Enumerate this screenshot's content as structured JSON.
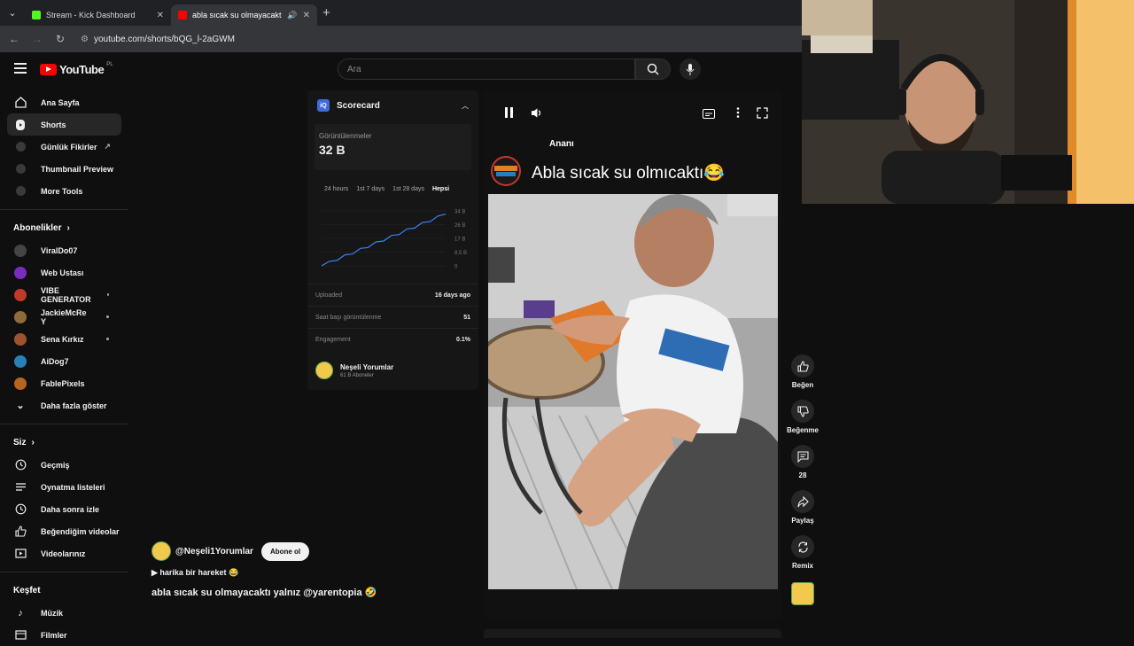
{
  "browser": {
    "tabs": [
      {
        "title": "Stream - Kick Dashboard",
        "favicon_color": "#53fc18"
      },
      {
        "title": "abla sıcak su olmayacaktı ya...",
        "favicon_color": "#ff0000"
      }
    ],
    "url": "youtube.com/shorts/bQG_l-2aGWM"
  },
  "header": {
    "logo": "YouTube",
    "country": "PL",
    "search_placeholder": "Ara"
  },
  "sidebar": {
    "main": [
      {
        "label": "Ana Sayfa",
        "icon": "home-icon"
      },
      {
        "label": "Shorts",
        "icon": "shorts-icon",
        "active": true
      },
      {
        "label": "Günlük Fikirler",
        "icon": "ext-app-icon"
      },
      {
        "label": "Thumbnail Preview",
        "icon": "ext-app-icon"
      },
      {
        "label": "More Tools",
        "icon": "ext-app-icon"
      }
    ],
    "subs_title": "Abonelikler",
    "subs": [
      {
        "label": "ViralDo07",
        "color": "#444"
      },
      {
        "label": "Web Ustası",
        "color": "#7b2cbf"
      },
      {
        "label": "VIBE GENERATOR",
        "color": "#c0392b"
      },
      {
        "label": "JackieMcRe Y",
        "color": "#8e6b3a"
      },
      {
        "label": "Sena Kırkız",
        "color": "#a0522d"
      },
      {
        "label": "AiDog7",
        "color": "#2980b9"
      },
      {
        "label": "FablePixels",
        "color": "#b5651d"
      }
    ],
    "show_more": "Daha fazla göster",
    "you_title": "Siz",
    "you": [
      {
        "label": "Geçmiş",
        "icon": "history-icon"
      },
      {
        "label": "Oynatma listeleri",
        "icon": "playlist-icon"
      },
      {
        "label": "Daha sonra izle",
        "icon": "clock-icon"
      },
      {
        "label": "Beğendiğim videolar",
        "icon": "like-icon"
      },
      {
        "label": "Videolarınız",
        "icon": "video-icon"
      }
    ],
    "explore_title": "Keşfet",
    "explore": [
      {
        "label": "Müzik",
        "icon": "music-icon"
      },
      {
        "label": "Filmler",
        "icon": "film-icon"
      }
    ]
  },
  "scorecard": {
    "title": "Scorecard",
    "views_label": "Görüntülenmeler",
    "views_value": "32 B",
    "ranges": [
      "24 hours",
      "1st 7 days",
      "1st 28 days",
      "Hepsi"
    ],
    "active_range": "Hepsi",
    "y_ticks": [
      "34 B",
      "26 B",
      "17 B",
      "8,5 B",
      "0"
    ],
    "stats": [
      {
        "label": "Uploaded",
        "value": "16 days ago"
      },
      {
        "label": "Saat başı görüntülenme",
        "value": "51"
      },
      {
        "label": "Engagement",
        "value": "0.1%"
      }
    ],
    "channel_name": "Neşeli Yorumlar",
    "channel_subs": "61 B Aboneler"
  },
  "player": {
    "overlay_label": "Ananı",
    "overlay_title": "Abla sıcak su olmıcaktı😂"
  },
  "caption": {
    "handle": "@Neşeli1Yorumlar",
    "subscribe": "Abone ol",
    "line": "▶ harika bir hareket 😂",
    "title": "abla sıcak su olmayacaktı yalnız @yarentopia 🤣"
  },
  "actions": [
    {
      "label": "Beğen",
      "icon": "thumbs-up-icon"
    },
    {
      "label": "Beğenme",
      "icon": "thumbs-down-icon"
    },
    {
      "label": "28",
      "icon": "comment-icon"
    },
    {
      "label": "Paylaş",
      "icon": "share-icon"
    },
    {
      "label": "Remix",
      "icon": "remix-icon"
    }
  ],
  "chart_data": {
    "type": "line",
    "x": [
      0,
      1,
      2,
      3,
      4,
      5,
      6,
      7,
      8,
      9,
      10,
      11,
      12,
      13,
      14,
      15,
      16
    ],
    "y": [
      0,
      2,
      4,
      6,
      8,
      10,
      12,
      14,
      16,
      18,
      20,
      22,
      24,
      26,
      28,
      30,
      32
    ],
    "ylim": [
      0,
      34
    ],
    "color": "#3b82f6"
  }
}
